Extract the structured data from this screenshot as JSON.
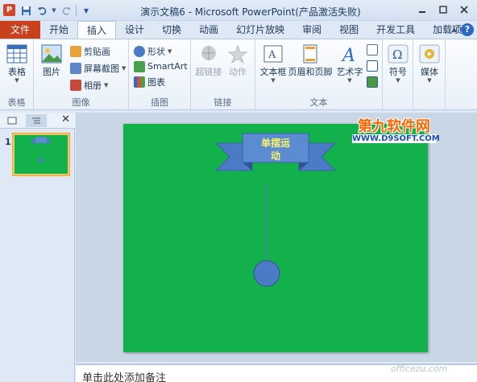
{
  "window": {
    "app_letter": "P",
    "title": "演示文稿6 - Microsoft PowerPoint(产品激活失败)",
    "controls": [
      "minimize",
      "maximize",
      "close"
    ]
  },
  "qat": {
    "items": [
      "save-icon",
      "undo-icon",
      "redo-icon",
      "customize-icon"
    ]
  },
  "tabs": {
    "file": "文件",
    "items": [
      "开始",
      "插入",
      "设计",
      "切换",
      "动画",
      "幻灯片放映",
      "审阅",
      "视图",
      "开发工具",
      "加载项"
    ],
    "active": "插入"
  },
  "ribbon": {
    "groups": {
      "tables": {
        "label": "表格",
        "buttons": {
          "table": "表格"
        }
      },
      "images": {
        "label": "图像",
        "buttons": {
          "picture": "图片",
          "clipart": "剪贴画",
          "screenshot": "屏幕截图",
          "album": "相册"
        }
      },
      "illustrations": {
        "label": "插图",
        "buttons": {
          "shapes": "形状",
          "smartart": "SmartArt",
          "chart": "图表"
        }
      },
      "links": {
        "label": "链接",
        "buttons": {
          "hyperlink": "超链接",
          "action": "动作"
        }
      },
      "text": {
        "label": "文本",
        "buttons": {
          "textbox": "文本框",
          "header_footer": "页眉和页脚",
          "wordart": "艺术字"
        }
      },
      "symbols": {
        "label": "",
        "buttons": {
          "symbol": "符号"
        }
      },
      "media": {
        "label": "",
        "buttons": {
          "media": "媒体"
        }
      }
    }
  },
  "slides_pane": {
    "slide_number": "1"
  },
  "slide": {
    "banner_text_line1": "单摆运",
    "banner_text_line2": "动",
    "background_color": "#12b14b",
    "banner_color": "#4a7bc4",
    "pendulum_color": "#4a7bc4"
  },
  "notes": {
    "placeholder": "单击此处添加备注"
  },
  "watermark": {
    "line1": "第九软件网",
    "line2": "WWW.D9SOFT.COM",
    "line3": "officezu.com"
  }
}
